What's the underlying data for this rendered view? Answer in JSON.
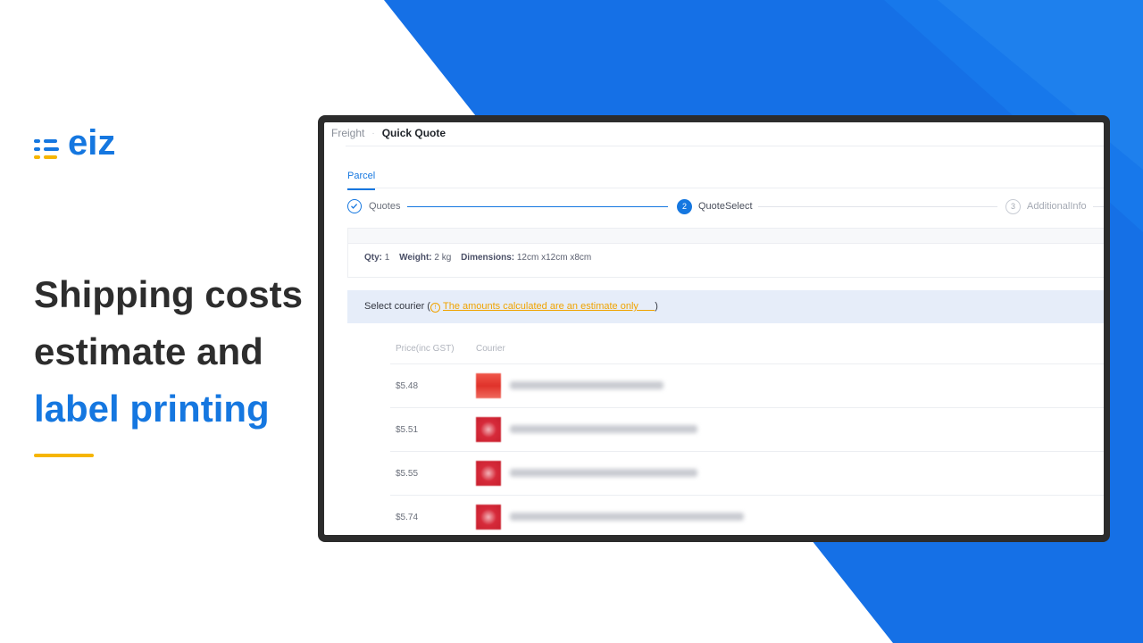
{
  "brand": {
    "logo_text": "eiz",
    "accent": "#1577e0",
    "accent_yellow": "#f6b500"
  },
  "headline": {
    "line1": "Shipping costs",
    "line2": "estimate and",
    "line3": "label printing"
  },
  "app": {
    "breadcrumb": {
      "parent": "Freight",
      "current": "Quick Quote"
    },
    "tab": "Parcel",
    "steps": [
      {
        "label": "Quotes",
        "state": "done",
        "icon": "check-icon"
      },
      {
        "label": "QuoteSelect",
        "state": "active",
        "number": "2"
      },
      {
        "label": "AdditionalInfo",
        "state": "pending",
        "number": "3"
      }
    ],
    "summary": {
      "qty_label": "Qty:",
      "qty_value": "1",
      "weight_label": "Weight:",
      "weight_value": "2 kg",
      "dims_label": "Dimensions:",
      "dims_value": "12cm x12cm x8cm"
    },
    "courier": {
      "label": "Select courier (",
      "note": "The amounts calculated are an estimate only",
      "close": ")"
    },
    "table": {
      "headers": {
        "price": "Price(inc GST)",
        "courier": "Courier"
      },
      "rows": [
        {
          "price": "$5.48"
        },
        {
          "price": "$5.51"
        },
        {
          "price": "$5.55"
        },
        {
          "price": "$5.74"
        }
      ]
    }
  }
}
